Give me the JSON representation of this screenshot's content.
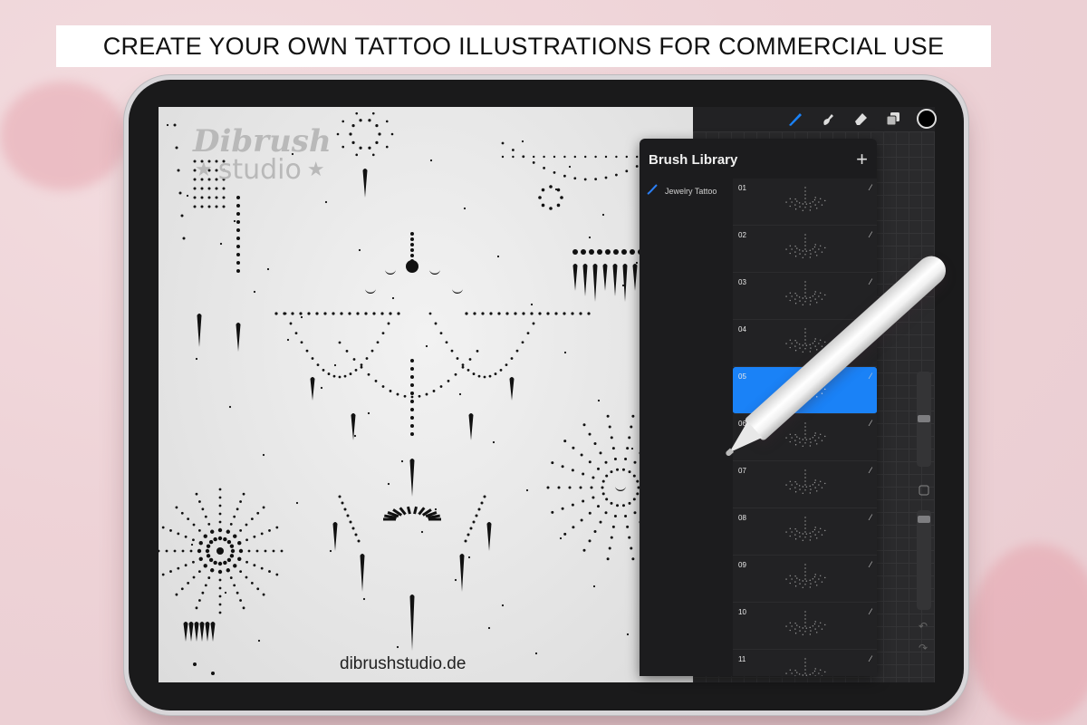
{
  "banner": {
    "text": "CREATE YOUR OWN TATTOO ILLUSTRATIONS FOR COMMERCIAL USE"
  },
  "canvas": {
    "logo_line1": "Dibrush",
    "logo_line2": "studio",
    "url": "dibrushstudio.de"
  },
  "toolbar": {
    "tools": [
      "brush-icon",
      "smudge-icon",
      "eraser-icon",
      "layers-icon",
      "color-picker"
    ],
    "active_color": "#000000"
  },
  "brush_library": {
    "title": "Brush Library",
    "add_label": "+",
    "brush_set": "Jewelry Tattoo",
    "brushes": [
      {
        "num": "01",
        "selected": false
      },
      {
        "num": "02",
        "selected": false
      },
      {
        "num": "03",
        "selected": false
      },
      {
        "num": "04",
        "selected": false
      },
      {
        "num": "05",
        "selected": true
      },
      {
        "num": "06",
        "selected": false
      },
      {
        "num": "07",
        "selected": false
      },
      {
        "num": "08",
        "selected": false
      },
      {
        "num": "09",
        "selected": false
      },
      {
        "num": "10",
        "selected": false
      },
      {
        "num": "11",
        "selected": false
      }
    ]
  },
  "colors": {
    "accent": "#1a82f7",
    "panel": "#1c1c1e"
  }
}
